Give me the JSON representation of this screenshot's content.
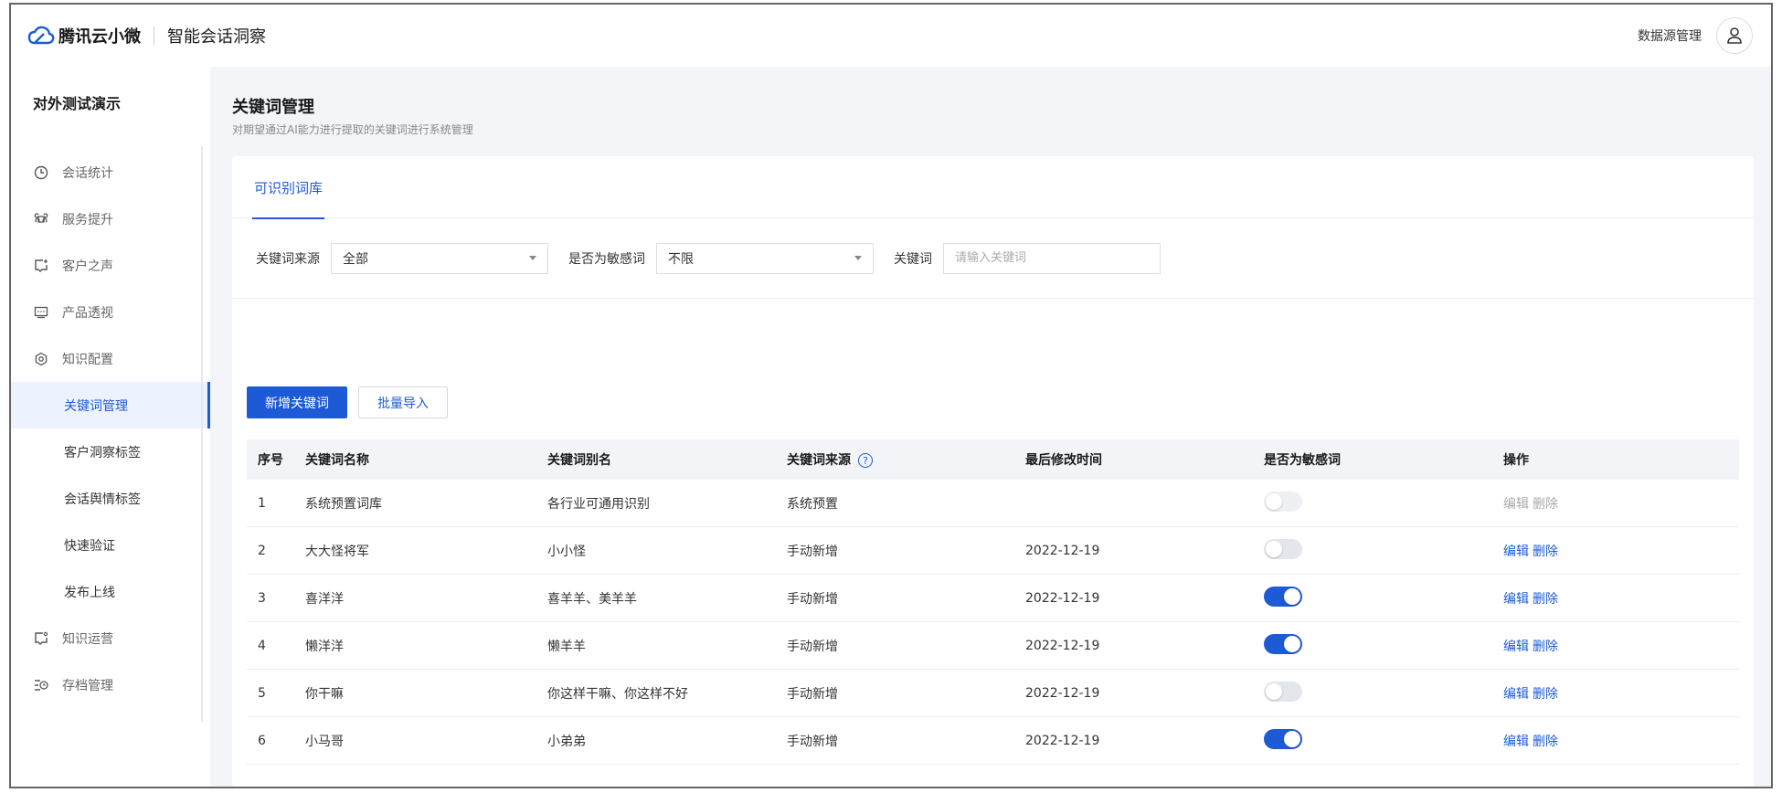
{
  "header": {
    "brand": "腾讯云小微",
    "product": "智能会话洞察",
    "datasource_link": "数据源管理"
  },
  "sidebar": {
    "workspace": "对外测试演示",
    "items": [
      {
        "label": "会话统计",
        "icon": "clock-icon"
      },
      {
        "label": "服务提升",
        "icon": "command-icon"
      },
      {
        "label": "客户之声",
        "icon": "chat-plus-icon"
      },
      {
        "label": "产品透视",
        "icon": "message-box-icon"
      },
      {
        "label": "知识配置",
        "icon": "settings-icon"
      },
      {
        "label": "关键词管理",
        "sub": true,
        "active": true
      },
      {
        "label": "客户洞察标签",
        "sub": true
      },
      {
        "label": "会话舆情标签",
        "sub": true
      },
      {
        "label": "快速验证",
        "sub": true
      },
      {
        "label": "发布上线",
        "sub": true
      },
      {
        "label": "知识运营",
        "icon": "chat-dot-icon"
      },
      {
        "label": "存档管理",
        "icon": "archive-icon"
      }
    ]
  },
  "page": {
    "title": "关键词管理",
    "description": "对期望通过AI能力进行提取的关键词进行系统管理"
  },
  "tabs": [
    {
      "label": "可识别词库",
      "active": true
    }
  ],
  "filters": {
    "source_label": "关键词来源",
    "source_value": "全部",
    "sensitive_label": "是否为敏感词",
    "sensitive_value": "不限",
    "keyword_label": "关键词",
    "keyword_placeholder": "请输入关键词",
    "keyword_value": ""
  },
  "buttons": {
    "add": "新增关键词",
    "import": "批量导入"
  },
  "table": {
    "columns": [
      "序号",
      "关键词名称",
      "关键词别名",
      "关键词来源",
      "最后修改时间",
      "是否为敏感词",
      "操作"
    ],
    "rows": [
      {
        "no": "1",
        "name": "系统预置词库",
        "alias": "各行业可通用识别",
        "source": "系统预置",
        "modified": "",
        "sensitive": false,
        "locked": true
      },
      {
        "no": "2",
        "name": "大大怪将军",
        "alias": "小小怪",
        "source": "手动新增",
        "modified": "2022-12-19",
        "sensitive": false,
        "locked": false
      },
      {
        "no": "3",
        "name": "喜洋洋",
        "alias": "喜羊羊、美羊羊",
        "source": "手动新增",
        "modified": "2022-12-19",
        "sensitive": true,
        "locked": false
      },
      {
        "no": "4",
        "name": "懒洋洋",
        "alias": "懒羊羊",
        "source": "手动新增",
        "modified": "2022-12-19",
        "sensitive": true,
        "locked": false
      },
      {
        "no": "5",
        "name": "你干嘛",
        "alias": "你这样干嘛、你这样不好",
        "source": "手动新增",
        "modified": "2022-12-19",
        "sensitive": false,
        "locked": false
      },
      {
        "no": "6",
        "name": "小马哥",
        "alias": "小弟弟",
        "source": "手动新增",
        "modified": "2022-12-19",
        "sensitive": true,
        "locked": false
      }
    ],
    "edit_label": "编辑",
    "delete_label": "删除"
  },
  "colors": {
    "primary": "#1d5bd6",
    "toggle_off": "#e3e6ec"
  }
}
